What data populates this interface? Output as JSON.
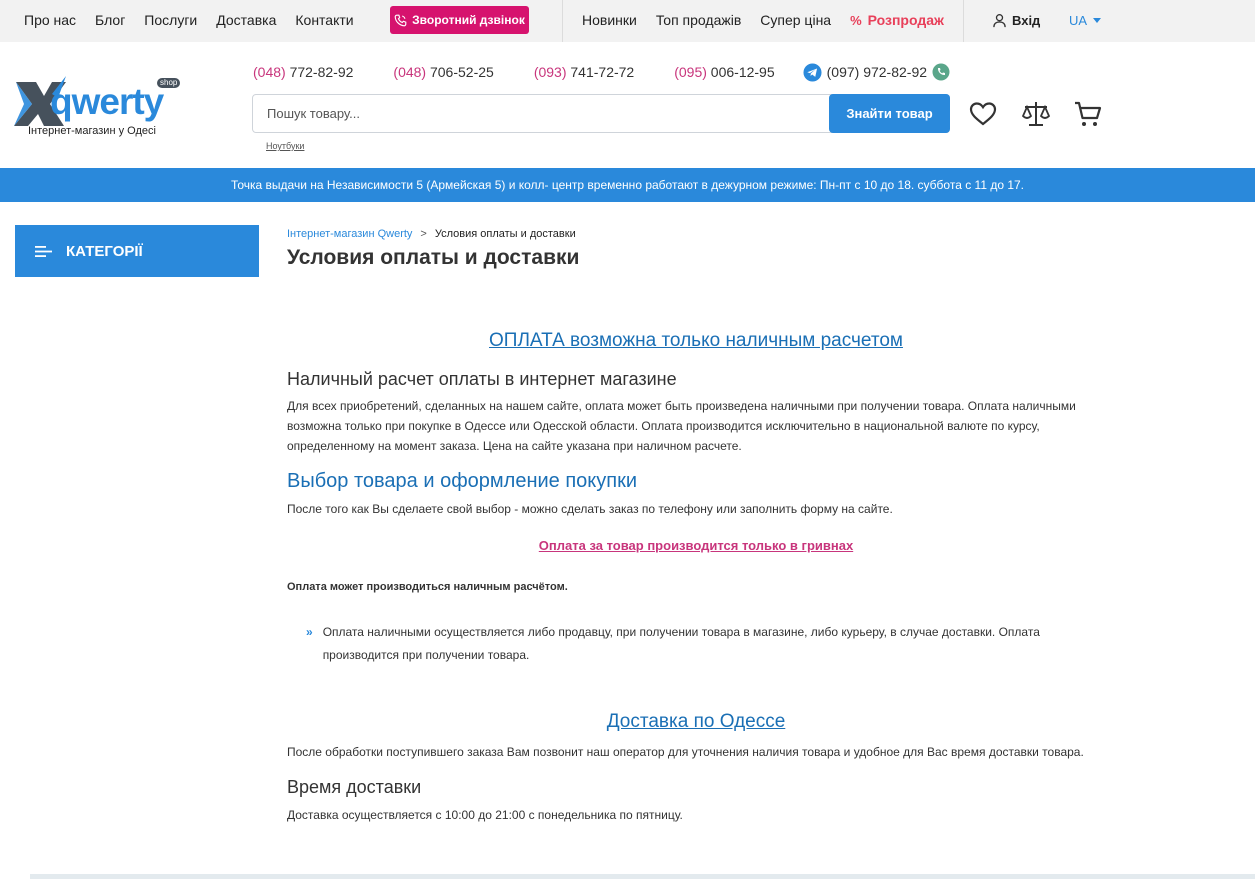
{
  "topbar": {
    "nav_left": [
      "Про нас",
      "Блог",
      "Послуги",
      "Доставка",
      "Контакти"
    ],
    "callback_label": "Зворотний дзвінок",
    "nav_right": [
      "Новинки",
      "Топ продажів",
      "Супер ціна"
    ],
    "sale_label": "Розпродаж",
    "login_label": "Вхід",
    "language": "UA"
  },
  "header": {
    "logo_text": "qwerty",
    "logo_badge": "shop",
    "logo_tagline": "Інтернет-магазин у Одесі",
    "phones": [
      {
        "code": "(048)",
        "number": "772-82-92"
      },
      {
        "code": "(048)",
        "number": "706-52-25"
      },
      {
        "code": "(093)",
        "number": "741-72-72"
      },
      {
        "code": "(095)",
        "number": "006-12-95"
      },
      {
        "code": "(097)",
        "number": "972-82-92"
      }
    ],
    "search_placeholder": "Пошук товару...",
    "search_button": "Знайти товар",
    "search_hint": "Ноутбуки"
  },
  "notice": "Точка выдачи на Независимости 5 (Армейская 5) и колл- центр временно работают в дежурном режиме: Пн-пт с 10 до 18. суббота с 11 до 17.",
  "sidebar": {
    "categories_label": "КАТЕГОРІЇ"
  },
  "breadcrumb": {
    "home": "Інтернет-магазин Qwerty",
    "separator": ">",
    "current": "Условия оплаты и доставки"
  },
  "page_title": "Условия оплаты и доставки",
  "content": {
    "payment_link": "ОПЛАТА возможна только наличным расчетом",
    "cash_heading": "Наличный расчет оплаты в интернет магазине",
    "cash_text": "Для всех приобретений, сделанных на нашем сайте, оплата может быть произведена наличными при получении товара. Оплата наличными возможна только при покупке в Одессе или Одесской области. Оплата производится исключительно в национальной валюте по курсу, определенному на момент заказа. Цена на сайте указана при наличном расчете.",
    "choice_heading": "Выбор товара и оформление покупки",
    "choice_text": "После того как Вы сделаете свой выбор - можно сделать заказ по телефону или заполнить форму на сайте.",
    "uah_link": "Оплата за товар производится только в гривнах",
    "cash_note": "Оплата может производиться наличным расчётом.",
    "bullet_chevron": "»",
    "bullet_text": "Оплата наличными осуществляется либо продавцу, при получении товара в магазине, либо курьеру, в случае доставки. Оплата производится при получении товара.",
    "delivery_link": "Доставка по Одессе",
    "delivery_text": "После обработки поступившего заказа Вам позвонит наш оператор для уточнения наличия товара и удобное для Вас время доставки товара.",
    "time_heading": "Время доставки",
    "time_text": "Доставка осуществляется с 10:00 до 21:00 с понедельника по пятницу."
  },
  "colors": {
    "accent_blue": "#2a89db",
    "pink": "#d6136e",
    "sale_red": "#e8405a",
    "link_blue": "#1a6fb5"
  },
  "icons": [
    "phone-icon",
    "percent-icon",
    "user-icon",
    "telegram-icon",
    "viber-icon",
    "heart-icon",
    "scales-icon",
    "cart-icon",
    "menu-icon"
  ]
}
